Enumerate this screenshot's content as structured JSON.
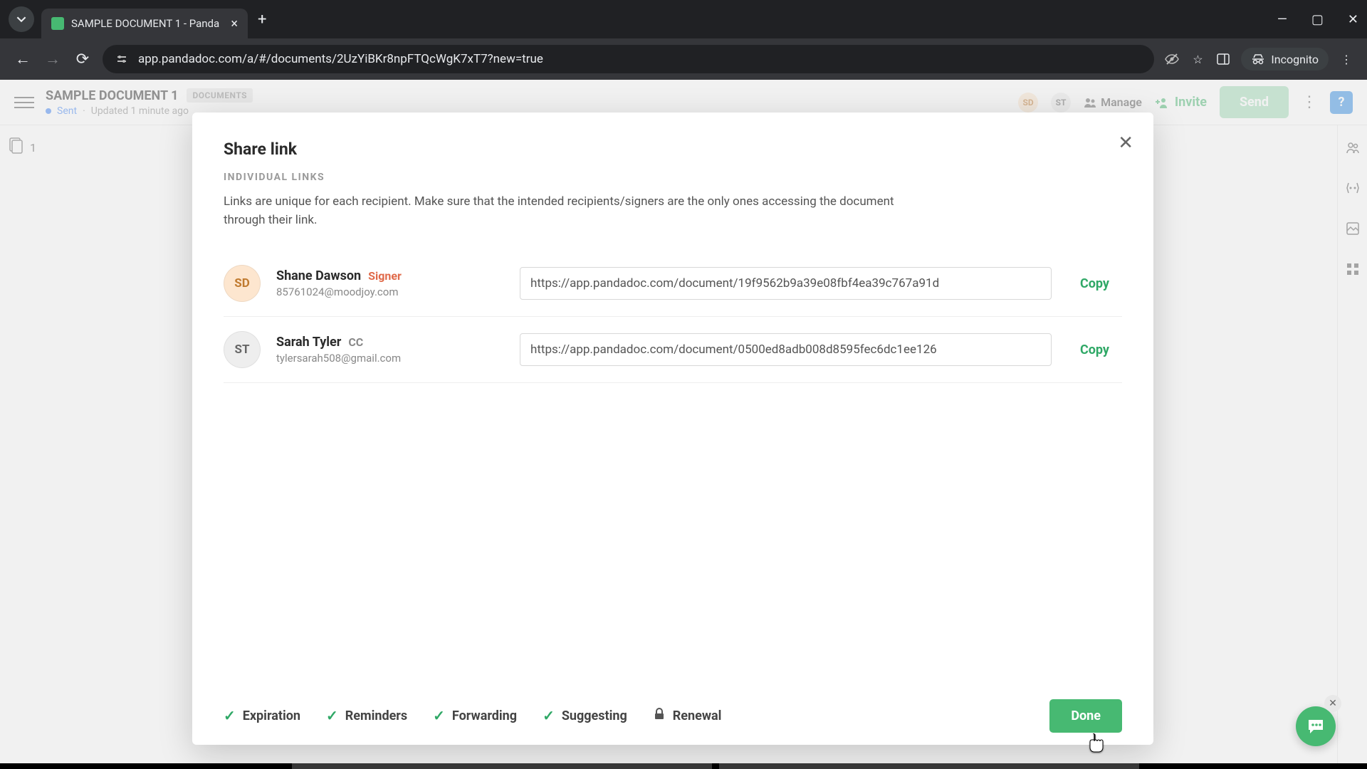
{
  "browser": {
    "tab_title": "SAMPLE DOCUMENT 1 - Panda",
    "url": "app.pandadoc.com/a/#/documents/2UzYiBKr8npFTQcWgK7xT7?new=true",
    "incognito_label": "Incognito"
  },
  "header": {
    "doc_title": "SAMPLE DOCUMENT 1",
    "badge": "DOCUMENTS",
    "status": "Sent",
    "updated": "Updated 1 minute ago",
    "avatars": [
      "SD",
      "ST"
    ],
    "manage": "Manage",
    "invite": "Invite",
    "send": "Send"
  },
  "left_rail": {
    "count": "1"
  },
  "dialog": {
    "title": "Share link",
    "section": "INDIVIDUAL LINKS",
    "description": "Links are unique for each recipient. Make sure that the intended recipients/signers are the only ones accessing the document through their link.",
    "recipients": [
      {
        "initials": "SD",
        "name": "Shane Dawson",
        "role": "Signer",
        "email": "85761024@moodjoy.com",
        "link": "https://app.pandadoc.com/document/19f9562b9a39e08fbf4ea39c767a91d",
        "copy": "Copy",
        "ava_class": "sd"
      },
      {
        "initials": "ST",
        "name": "Sarah Tyler",
        "role": "CC",
        "email": "tylersarah508@gmail.com",
        "link": "https://app.pandadoc.com/document/0500ed8adb008d8595fec6dc1ee126",
        "copy": "Copy",
        "ava_class": "st"
      }
    ],
    "options": [
      {
        "icon": "check",
        "label": "Expiration"
      },
      {
        "icon": "check",
        "label": "Reminders"
      },
      {
        "icon": "check",
        "label": "Forwarding"
      },
      {
        "icon": "check",
        "label": "Suggesting"
      },
      {
        "icon": "lock",
        "label": "Renewal"
      }
    ],
    "done": "Done"
  }
}
